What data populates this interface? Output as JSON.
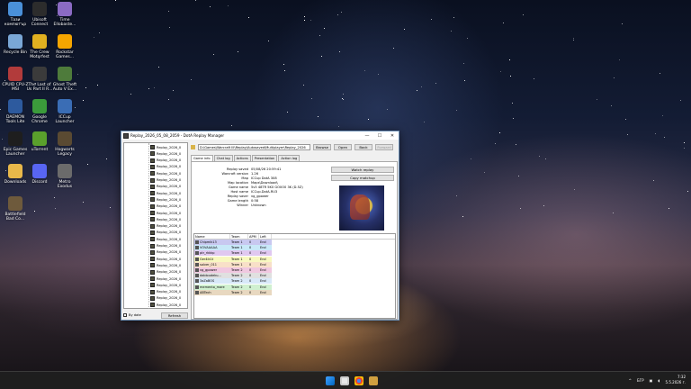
{
  "desktop": {
    "icons": [
      {
        "label": "Тази\nкомпютър",
        "color": "#4a90d9"
      },
      {
        "label": "Ubisoft\nConnect",
        "color": "#2c2c2c"
      },
      {
        "label": "Time\nEllobaste...",
        "color": "#8b6bc4"
      },
      {
        "label": "Recycle Bin",
        "color": "#7aa7d6"
      },
      {
        "label": "The Crew\nMotorfest",
        "color": "#e0b020"
      },
      {
        "label": "Rockstar\nGames...",
        "color": "#f5a500"
      },
      {
        "label": "CPUID CPU-Z\nMSI",
        "color": "#b23b3b"
      },
      {
        "label": "The Last of\nUs Part II R...",
        "color": "#3b3b3b"
      },
      {
        "label": "Ghost Theft\nAuto V Ex...",
        "color": "#4e7b3b"
      },
      {
        "label": "DAEMON\nTools Lite",
        "color": "#2d5a9e"
      },
      {
        "label": "Google\nChrome",
        "color": "#3b9b3b"
      },
      {
        "label": "ICCup\nLauncher",
        "color": "#3a6db5"
      },
      {
        "label": "Epic Games\nLauncher",
        "color": "#1e1e1e"
      },
      {
        "label": "uTorrent",
        "color": "#5aa02c"
      },
      {
        "label": "Hogwarts\nLegacy",
        "color": "#5a4a32"
      },
      {
        "label": "Downloads",
        "color": "#e8b84a"
      },
      {
        "label": "Discord",
        "color": "#5865f2"
      },
      {
        "label": "Metro\nExodus",
        "color": "#6b6b6b"
      },
      {
        "label": "Battlefield\nBad Co...",
        "color": "#6e5a3c"
      }
    ]
  },
  "window": {
    "title": "Replay_2026_05_08_2059 - DotA Replay Manager",
    "minimize": "—",
    "maximize": "☐",
    "close": "✕",
    "files": [
      "Replay_2026_0",
      "Replay_2026_0",
      "Replay_2026_0",
      "Replay_2026_0",
      "Replay_2026_0",
      "Replay_2026_0",
      "Replay_2026_0",
      "Replay_2026_0",
      "Replay_2026_0",
      "Replay_2026_0",
      "Replay_2026_0",
      "Replay_2026_0",
      "Replay_2026_0",
      "Replay_2026_0",
      "Replay_2026_0",
      "Replay_2026_0",
      "Replay_2026_0",
      "Replay_2026_0",
      "Replay_2026_0",
      "Replay_2026_0",
      "Replay_2026_0",
      "Replay_2026_0",
      "Replay_2026_0",
      "Replay_2026_0",
      "Replay_2026_0"
    ],
    "sort_label": "By date",
    "refresh_label": "Refresh",
    "path": "D:\\Games\\Warcraft III\\Replay\\Autosaved\\Multiplayer\\Replay_2026",
    "browse_label": "Browse",
    "open_label": "Open",
    "back_label": "Back",
    "forward_label": "Forward",
    "tabs": [
      "Game info",
      "Chat log",
      "Actions",
      "Presentation",
      "Action log"
    ],
    "info": [
      {
        "k": "Replay saved",
        "v": "05/08/26 20:59:41"
      },
      {
        "k": "Warcraft version",
        "v": "1.26"
      },
      {
        "k": "Map",
        "v": "ICCup DotA 308"
      },
      {
        "k": "Map location",
        "v": "Maps\\Download\\"
      },
      {
        "k": "Game name",
        "v": "5v5 48TR 5K0 GO0O0 3K (D.5Z)"
      },
      {
        "k": "Host name",
        "v": "ICCup.DotA.RU3"
      },
      {
        "k": "Replay saver",
        "v": "vg_gpower"
      },
      {
        "k": "Game length",
        "v": "0:58"
      },
      {
        "k": "Winner",
        "v": "Unknown"
      }
    ],
    "watch_label": "Watch replay",
    "copy_label": "Copy matchup",
    "players_header": {
      "name": "Name",
      "team": "Team",
      "apm": "APM",
      "left": "Left"
    },
    "players": [
      {
        "name": "Chipmik13",
        "team": "Team 1",
        "apm": "0",
        "left": "End",
        "bg": "#c8c8f0"
      },
      {
        "name": "VOVAAAAA",
        "team": "Team 1",
        "apm": "0",
        "left": "End",
        "bg": "#c8e8f8"
      },
      {
        "name": "ptr_rkkkp",
        "team": "Team 1",
        "apm": "0",
        "left": "End",
        "bg": "#e0c8f0"
      },
      {
        "name": "Ger4ik1t",
        "team": "Team 1",
        "apm": "0",
        "left": "End",
        "bg": "#f8f8c0"
      },
      {
        "name": "solver_011",
        "team": "Team 1",
        "apm": "0",
        "left": "End",
        "bg": "#f8e0c8"
      },
      {
        "name": "vg_gpower",
        "team": "Team 2",
        "apm": "0",
        "left": "End",
        "bg": "#f0c8e0"
      },
      {
        "name": "dabloudeku...",
        "team": "Team 2",
        "apm": "0",
        "left": "End",
        "bg": "#e0e0e0"
      },
      {
        "name": "3aZaBOS",
        "team": "Team 2",
        "apm": "0",
        "left": "End",
        "bg": "#d8e8f8"
      },
      {
        "name": "memento_mare",
        "team": "Team 2",
        "apm": "0",
        "left": "End",
        "bg": "#d0f0d0"
      },
      {
        "name": "ABTech",
        "team": "Team 2",
        "apm": "0",
        "left": "End",
        "bg": "#e8d8c0"
      }
    ]
  },
  "taskbar": {
    "lang": "БГР",
    "time": "7:32",
    "date": "5.5.2026 г."
  }
}
